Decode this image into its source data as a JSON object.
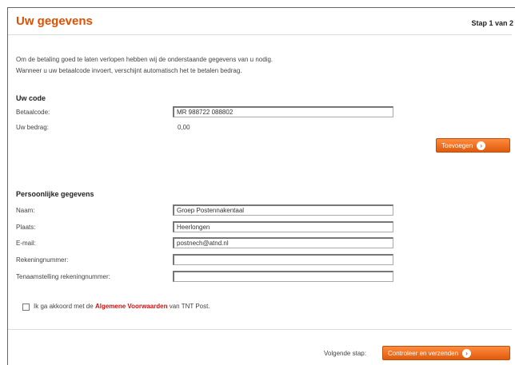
{
  "header": {
    "title": "Uw gegevens",
    "step": "Stap 1 van 2"
  },
  "intro": {
    "line1": "Om de betaling goed te laten verlopen hebben wij de onderstaande gegevens van u nodig.",
    "line2": "Wanneer u uw betaalcode invoert, verschijnt automatisch het te betalen bedrag."
  },
  "code_section": {
    "title": "Uw code",
    "betaalcode_label": "Betaalcode:",
    "betaalcode_value": "MR 988722 088802",
    "bedrag_label": "Uw bedrag:",
    "bedrag_value": "0,00",
    "button_label": "Toevoegen"
  },
  "personal_section": {
    "title": "Persoonlijke gegevens",
    "fields": [
      {
        "label": "Naam:",
        "value": "Groep Postennakentaal"
      },
      {
        "label": "Plaats:",
        "value": "Heerlongen"
      },
      {
        "label": "E-mail:",
        "value": "postnech@atnd.nl"
      },
      {
        "label": "Rekeningnummer:",
        "value": ""
      },
      {
        "label": "Tenaamstelling rekeningnummer:",
        "value": ""
      }
    ]
  },
  "terms": {
    "prefix": "Ik ga akkoord met de",
    "link": "Algemene Voorwaarden",
    "suffix": "van TNT Post."
  },
  "footer": {
    "next_label": "Volgende stap:",
    "next_button": "Controleer en verzenden"
  },
  "colors": {
    "accent": "#e05000",
    "button": "#f07020",
    "link": "#d01010"
  }
}
